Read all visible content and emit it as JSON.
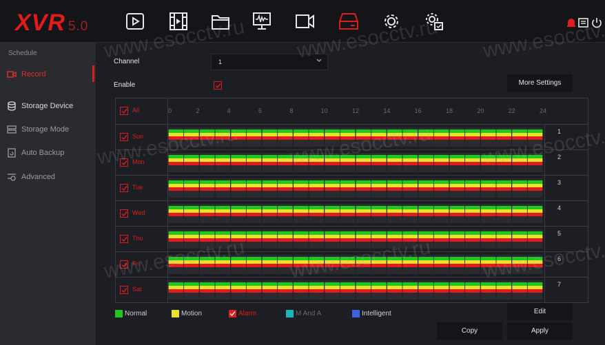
{
  "app": {
    "logo": "XVR",
    "version": "5.0"
  },
  "colors": {
    "accent": "#e01c1c",
    "normal": "#1fc81f",
    "motion": "#ece02a",
    "alarm": "#e01c1c",
    "mand": "#18b6b6",
    "intelligent": "#3e63dd"
  },
  "topnav": {
    "icons": [
      "playback-icon",
      "video-film-icon",
      "folder-icon",
      "monitor-waveform-icon",
      "camera-icon",
      "storage-drive-icon",
      "settings-gear-icon",
      "system-maintenance-icon"
    ],
    "active_index": 5,
    "right_icons": [
      "alert-bell-icon",
      "message-icon",
      "power-icon"
    ]
  },
  "sidebar": {
    "section_title": "Schedule",
    "items": [
      {
        "label": "Record",
        "icon": "record-icon"
      },
      {
        "label": "Storage Device",
        "icon": "database-icon"
      },
      {
        "label": "Storage Mode",
        "icon": "storage-mode-icon"
      },
      {
        "label": "Auto Backup",
        "icon": "backup-icon"
      },
      {
        "label": "Advanced",
        "icon": "advanced-icon"
      }
    ]
  },
  "form": {
    "channel_label": "Channel",
    "channel_value": "1",
    "enable_label": "Enable",
    "enable_checked": true,
    "more_settings": "More Settings"
  },
  "schedule": {
    "all_label": "All",
    "hours": [
      "0",
      "2",
      "4",
      "6",
      "8",
      "10",
      "12",
      "14",
      "16",
      "18",
      "20",
      "22",
      "24"
    ],
    "days": [
      {
        "label": "Sun",
        "num": "1"
      },
      {
        "label": "Mon",
        "num": "2"
      },
      {
        "label": "Tue",
        "num": "3"
      },
      {
        "label": "Wed",
        "num": "4"
      },
      {
        "label": "Thu",
        "num": "5"
      },
      {
        "label": "Fri",
        "num": "6"
      },
      {
        "label": "Sat",
        "num": "7"
      }
    ],
    "segments": [
      "normal",
      "motion",
      "alarm"
    ]
  },
  "legend": [
    {
      "label": "Normal",
      "type": "normal"
    },
    {
      "label": "Motion",
      "type": "motion"
    },
    {
      "label": "Alarm",
      "type": "alarm"
    },
    {
      "label": "M And A",
      "type": "mand"
    },
    {
      "label": "Intelligent",
      "type": "intelligent"
    }
  ],
  "buttons": {
    "edit": "Edit",
    "copy": "Copy",
    "apply": "Apply"
  },
  "watermark": "www.esocctv.ru"
}
